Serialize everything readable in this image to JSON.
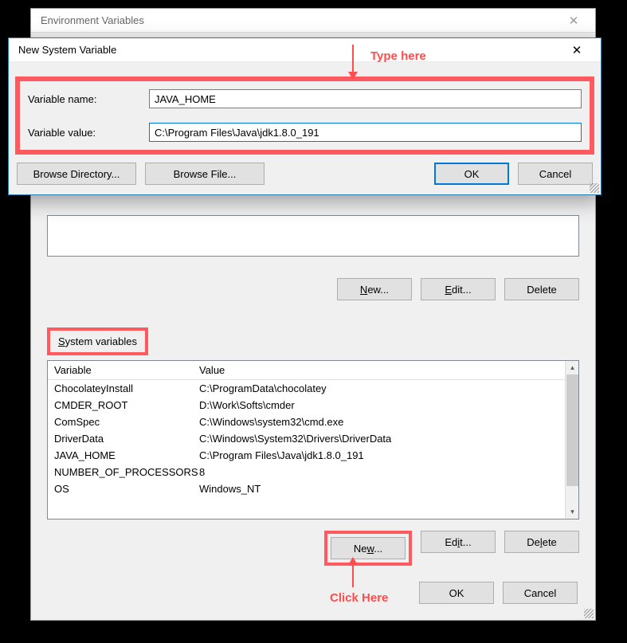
{
  "envWindow": {
    "title": "Environment Variables",
    "userBox": {},
    "userButtons": {
      "new": "New...",
      "edit": "Edit...",
      "delete": "Delete"
    },
    "systemSection": {
      "label": "System variables",
      "columns": {
        "var": "Variable",
        "val": "Value"
      },
      "rows": [
        {
          "var": "ChocolateyInstall",
          "val": "C:\\ProgramData\\chocolatey"
        },
        {
          "var": "CMDER_ROOT",
          "val": "D:\\Work\\Softs\\cmder"
        },
        {
          "var": "ComSpec",
          "val": "C:\\Windows\\system32\\cmd.exe"
        },
        {
          "var": "DriverData",
          "val": "C:\\Windows\\System32\\Drivers\\DriverData"
        },
        {
          "var": "JAVA_HOME",
          "val": "C:\\Program Files\\Java\\jdk1.8.0_191"
        },
        {
          "var": "NUMBER_OF_PROCESSORS",
          "val": "8"
        },
        {
          "var": "OS",
          "val": "Windows_NT"
        }
      ]
    },
    "sysButtons": {
      "new": "New...",
      "edit": "Edit...",
      "delete": "Delete"
    },
    "footer": {
      "ok": "OK",
      "cancel": "Cancel"
    }
  },
  "newDialog": {
    "title": "New System Variable",
    "labels": {
      "name": "Variable name:",
      "value": "Variable value:"
    },
    "values": {
      "name": "JAVA_HOME",
      "value": "C:\\Program Files\\Java\\jdk1.8.0_191"
    },
    "buttons": {
      "browseDir": "Browse Directory...",
      "browseFile": "Browse File...",
      "ok": "OK",
      "cancel": "Cancel"
    }
  },
  "annotations": {
    "typeHere": "Type here",
    "clickHere": "Click Here"
  }
}
